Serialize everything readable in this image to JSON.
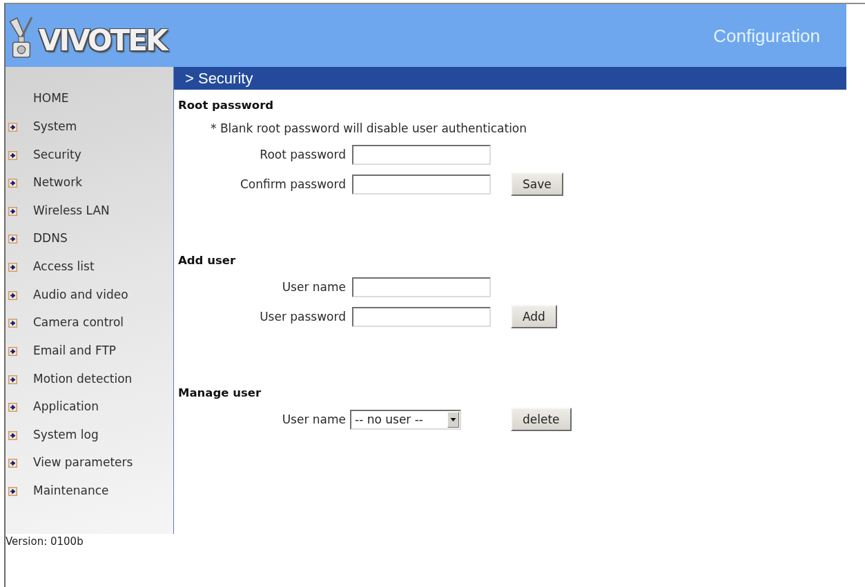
{
  "header": {
    "logo": "VIVOTEK",
    "title": "Configuration"
  },
  "sidebar": {
    "items": [
      {
        "kind": "home",
        "label": "HOME"
      },
      {
        "kind": "link",
        "label": "System"
      },
      {
        "kind": "link",
        "label": "Security"
      },
      {
        "kind": "link",
        "label": "Network"
      },
      {
        "kind": "link",
        "label": "Wireless LAN"
      },
      {
        "kind": "link",
        "label": "DDNS"
      },
      {
        "kind": "link",
        "label": "Access list"
      },
      {
        "kind": "link",
        "label": "Audio and video"
      },
      {
        "kind": "link",
        "label": "Camera control"
      },
      {
        "kind": "link",
        "label": "Email and FTP"
      },
      {
        "kind": "link",
        "label": "Motion detection"
      },
      {
        "kind": "link",
        "label": "Application"
      },
      {
        "kind": "link",
        "label": "System log"
      },
      {
        "kind": "link",
        "label": "View parameters"
      },
      {
        "kind": "link",
        "label": "Maintenance"
      }
    ],
    "version": "Version: 0100b"
  },
  "content": {
    "title": "> Security",
    "sections": [
      {
        "heading": "Root password",
        "note": "* Blank root password will disable user authentication",
        "fields": [
          {
            "kind": "input",
            "label": "Root password"
          },
          {
            "kind": "input",
            "label": "Confirm password"
          }
        ],
        "button": "Save"
      },
      {
        "heading": "Add user",
        "fields": [
          {
            "kind": "input",
            "label": "User name"
          },
          {
            "kind": "input",
            "label": "User password"
          }
        ],
        "button": "Add"
      },
      {
        "heading": "Manage user",
        "fields": [
          {
            "kind": "select",
            "label": "User name",
            "value": "-- no user --"
          }
        ],
        "button": "delete"
      }
    ]
  }
}
